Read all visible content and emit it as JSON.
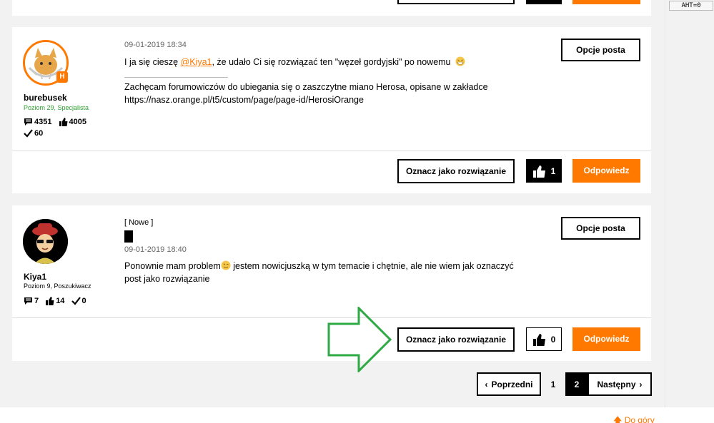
{
  "debug": {
    "aht_label": "AHT=0"
  },
  "posts": [
    {
      "author": "burebusek",
      "rank": "Poziom 29, Specjalista",
      "rank_color": "#2da02d",
      "badge": "H",
      "stats": {
        "messages": "4351",
        "kudos": "4005",
        "solutions": "60"
      },
      "date": "09-01-2019 18:34",
      "body_prefix": "I ja się cieszę ",
      "mention": "@Kiya1",
      "body_suffix": ", że udało Ci się rozwiązać ten \"węzeł gordyjski\" po nowemu",
      "signature_line1": "Zachęcam forumowiczów do ubiegania się o zaszczytne miano Herosa, opisane w zakładce",
      "signature_line2": "https://nasz.orange.pl/t5/custom/page/page-id/HerosiOrange",
      "options_label": "Opcje posta",
      "mark_solution_label": "Oznacz jako rozwiązanie",
      "kudos_count": "1",
      "reply_label": "Odpowiedz"
    },
    {
      "new_label": "[ Nowe ]",
      "author": "Kiya1",
      "rank": "Poziom 9, Poszukiwacz",
      "rank_color": "#000000",
      "stats": {
        "messages": "7",
        "kudos": "14",
        "solutions": "0"
      },
      "date": "09-01-2019 18:40",
      "body_line1_a": "Ponownie mam problem",
      "body_line1_b": " jestem nowicjuszką w tym temacie i chętnie, ale nie wiem jak oznaczyć",
      "body_line2": "post jako rozwiązanie",
      "options_label": "Opcje posta",
      "mark_solution_label": "Oznacz jako rozwiązanie",
      "kudos_count": "0",
      "reply_label": "Odpowiedz"
    }
  ],
  "pagination": {
    "prev_label": "Poprzedni",
    "pages": [
      "1",
      "2"
    ],
    "current_page": "2",
    "next_label": "Następny"
  },
  "footer": {
    "back_to_top_label": "Do góry"
  },
  "colors": {
    "accent": "#ff7900",
    "arrow": "#2eaa44"
  }
}
